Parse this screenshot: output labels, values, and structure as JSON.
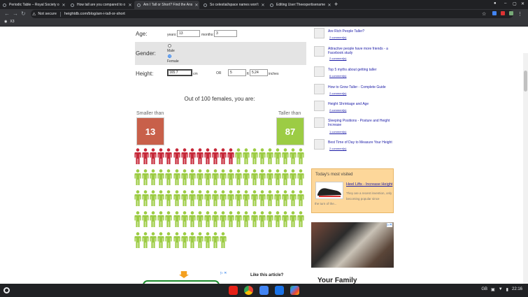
{
  "browser": {
    "tabs": [
      {
        "title": "Periodic Table – Royal Society o",
        "active": false
      },
      {
        "title": "How tall are you compared to o",
        "active": false
      },
      {
        "title": "Am I Tall or Short? Find the Ans",
        "active": true
      },
      {
        "title": "So celestial/space names won't",
        "active": false
      },
      {
        "title": "Editing User:Theexpertisename",
        "active": false
      }
    ],
    "security_label": "Not secure",
    "url": "heightdb.com/blog/am-i-tall-or-short",
    "bookmark_label": "X3"
  },
  "form": {
    "age_label": "Age:",
    "years_label": "years:",
    "years_value": "13",
    "months_label": "months:",
    "months_value": "3",
    "gender_label": "Gender:",
    "male_label": "Male",
    "female_label": "Female",
    "gender_selected": "Female",
    "height_label": "Height:",
    "height_cm_value": "165.7",
    "cm_label": "cm",
    "or_label": "OR",
    "ft_value": "5",
    "ft_label": "ft",
    "inches_value": "5.24",
    "inches_label": "inches"
  },
  "result": {
    "heading": "Out of 100 females, you are:",
    "smaller_label": "Smaller than",
    "smaller_value": "13",
    "taller_label": "Taller than",
    "taller_value": "87",
    "red_count": 13,
    "total_count": 100,
    "red_color": "#c62839",
    "green_color": "#9ccc44"
  },
  "sidebar": {
    "articles": [
      {
        "title": "Are Rich People Taller?",
        "comments": "2 comment(s)"
      },
      {
        "title": "Attractive people have more friends - a Facebook study",
        "comments": "2 comment(s)"
      },
      {
        "title": "Top 5 myths about getting taller",
        "comments": "6 comment(s)"
      },
      {
        "title": "How to Grow Taller - Complete Guide",
        "comments": "2 comment(s)"
      },
      {
        "title": "Height Shrinkage and Age",
        "comments": "2 comment(s)"
      },
      {
        "title": "Sleeping Positions - Posture and Height Increase",
        "comments": "1 comment(s)"
      },
      {
        "title": "Best Time of Day to Measure Your Height",
        "comments": "2 comment(s)"
      }
    ],
    "most_visited": {
      "heading": "Today's most visited",
      "link": "Heel Lifts - Increase Height",
      "description": "They are a recent invention, only becoming popular since",
      "description_cont": "the turn of the..."
    },
    "ad_text": "Your Family"
  },
  "bottom": {
    "like_text": "Like this article?"
  },
  "taskbar": {
    "locale": "GB",
    "time": "22:16"
  }
}
